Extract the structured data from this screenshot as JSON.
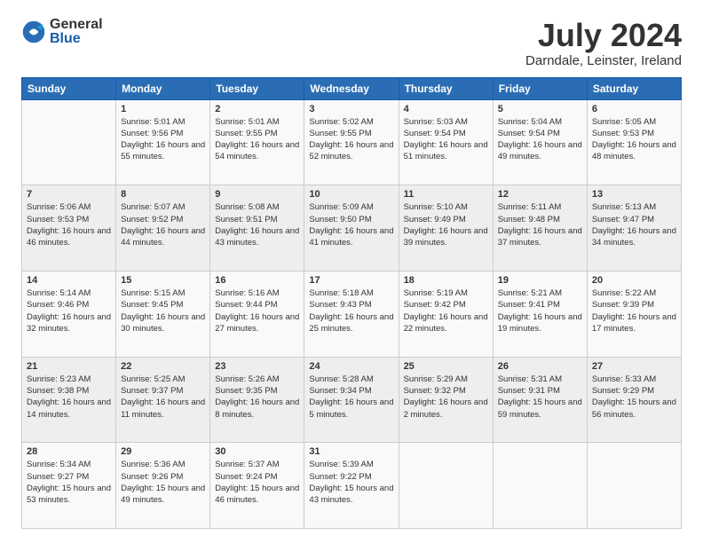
{
  "logo": {
    "general": "General",
    "blue": "Blue"
  },
  "title": "July 2024",
  "location": "Darndale, Leinster, Ireland",
  "days_of_week": [
    "Sunday",
    "Monday",
    "Tuesday",
    "Wednesday",
    "Thursday",
    "Friday",
    "Saturday"
  ],
  "weeks": [
    [
      {
        "day": "",
        "sunrise": "",
        "sunset": "",
        "daylight": ""
      },
      {
        "day": "1",
        "sunrise": "Sunrise: 5:01 AM",
        "sunset": "Sunset: 9:56 PM",
        "daylight": "Daylight: 16 hours and 55 minutes."
      },
      {
        "day": "2",
        "sunrise": "Sunrise: 5:01 AM",
        "sunset": "Sunset: 9:55 PM",
        "daylight": "Daylight: 16 hours and 54 minutes."
      },
      {
        "day": "3",
        "sunrise": "Sunrise: 5:02 AM",
        "sunset": "Sunset: 9:55 PM",
        "daylight": "Daylight: 16 hours and 52 minutes."
      },
      {
        "day": "4",
        "sunrise": "Sunrise: 5:03 AM",
        "sunset": "Sunset: 9:54 PM",
        "daylight": "Daylight: 16 hours and 51 minutes."
      },
      {
        "day": "5",
        "sunrise": "Sunrise: 5:04 AM",
        "sunset": "Sunset: 9:54 PM",
        "daylight": "Daylight: 16 hours and 49 minutes."
      },
      {
        "day": "6",
        "sunrise": "Sunrise: 5:05 AM",
        "sunset": "Sunset: 9:53 PM",
        "daylight": "Daylight: 16 hours and 48 minutes."
      }
    ],
    [
      {
        "day": "7",
        "sunrise": "Sunrise: 5:06 AM",
        "sunset": "Sunset: 9:53 PM",
        "daylight": "Daylight: 16 hours and 46 minutes."
      },
      {
        "day": "8",
        "sunrise": "Sunrise: 5:07 AM",
        "sunset": "Sunset: 9:52 PM",
        "daylight": "Daylight: 16 hours and 44 minutes."
      },
      {
        "day": "9",
        "sunrise": "Sunrise: 5:08 AM",
        "sunset": "Sunset: 9:51 PM",
        "daylight": "Daylight: 16 hours and 43 minutes."
      },
      {
        "day": "10",
        "sunrise": "Sunrise: 5:09 AM",
        "sunset": "Sunset: 9:50 PM",
        "daylight": "Daylight: 16 hours and 41 minutes."
      },
      {
        "day": "11",
        "sunrise": "Sunrise: 5:10 AM",
        "sunset": "Sunset: 9:49 PM",
        "daylight": "Daylight: 16 hours and 39 minutes."
      },
      {
        "day": "12",
        "sunrise": "Sunrise: 5:11 AM",
        "sunset": "Sunset: 9:48 PM",
        "daylight": "Daylight: 16 hours and 37 minutes."
      },
      {
        "day": "13",
        "sunrise": "Sunrise: 5:13 AM",
        "sunset": "Sunset: 9:47 PM",
        "daylight": "Daylight: 16 hours and 34 minutes."
      }
    ],
    [
      {
        "day": "14",
        "sunrise": "Sunrise: 5:14 AM",
        "sunset": "Sunset: 9:46 PM",
        "daylight": "Daylight: 16 hours and 32 minutes."
      },
      {
        "day": "15",
        "sunrise": "Sunrise: 5:15 AM",
        "sunset": "Sunset: 9:45 PM",
        "daylight": "Daylight: 16 hours and 30 minutes."
      },
      {
        "day": "16",
        "sunrise": "Sunrise: 5:16 AM",
        "sunset": "Sunset: 9:44 PM",
        "daylight": "Daylight: 16 hours and 27 minutes."
      },
      {
        "day": "17",
        "sunrise": "Sunrise: 5:18 AM",
        "sunset": "Sunset: 9:43 PM",
        "daylight": "Daylight: 16 hours and 25 minutes."
      },
      {
        "day": "18",
        "sunrise": "Sunrise: 5:19 AM",
        "sunset": "Sunset: 9:42 PM",
        "daylight": "Daylight: 16 hours and 22 minutes."
      },
      {
        "day": "19",
        "sunrise": "Sunrise: 5:21 AM",
        "sunset": "Sunset: 9:41 PM",
        "daylight": "Daylight: 16 hours and 19 minutes."
      },
      {
        "day": "20",
        "sunrise": "Sunrise: 5:22 AM",
        "sunset": "Sunset: 9:39 PM",
        "daylight": "Daylight: 16 hours and 17 minutes."
      }
    ],
    [
      {
        "day": "21",
        "sunrise": "Sunrise: 5:23 AM",
        "sunset": "Sunset: 9:38 PM",
        "daylight": "Daylight: 16 hours and 14 minutes."
      },
      {
        "day": "22",
        "sunrise": "Sunrise: 5:25 AM",
        "sunset": "Sunset: 9:37 PM",
        "daylight": "Daylight: 16 hours and 11 minutes."
      },
      {
        "day": "23",
        "sunrise": "Sunrise: 5:26 AM",
        "sunset": "Sunset: 9:35 PM",
        "daylight": "Daylight: 16 hours and 8 minutes."
      },
      {
        "day": "24",
        "sunrise": "Sunrise: 5:28 AM",
        "sunset": "Sunset: 9:34 PM",
        "daylight": "Daylight: 16 hours and 5 minutes."
      },
      {
        "day": "25",
        "sunrise": "Sunrise: 5:29 AM",
        "sunset": "Sunset: 9:32 PM",
        "daylight": "Daylight: 16 hours and 2 minutes."
      },
      {
        "day": "26",
        "sunrise": "Sunrise: 5:31 AM",
        "sunset": "Sunset: 9:31 PM",
        "daylight": "Daylight: 15 hours and 59 minutes."
      },
      {
        "day": "27",
        "sunrise": "Sunrise: 5:33 AM",
        "sunset": "Sunset: 9:29 PM",
        "daylight": "Daylight: 15 hours and 56 minutes."
      }
    ],
    [
      {
        "day": "28",
        "sunrise": "Sunrise: 5:34 AM",
        "sunset": "Sunset: 9:27 PM",
        "daylight": "Daylight: 15 hours and 53 minutes."
      },
      {
        "day": "29",
        "sunrise": "Sunrise: 5:36 AM",
        "sunset": "Sunset: 9:26 PM",
        "daylight": "Daylight: 15 hours and 49 minutes."
      },
      {
        "day": "30",
        "sunrise": "Sunrise: 5:37 AM",
        "sunset": "Sunset: 9:24 PM",
        "daylight": "Daylight: 15 hours and 46 minutes."
      },
      {
        "day": "31",
        "sunrise": "Sunrise: 5:39 AM",
        "sunset": "Sunset: 9:22 PM",
        "daylight": "Daylight: 15 hours and 43 minutes."
      },
      {
        "day": "",
        "sunrise": "",
        "sunset": "",
        "daylight": ""
      },
      {
        "day": "",
        "sunrise": "",
        "sunset": "",
        "daylight": ""
      },
      {
        "day": "",
        "sunrise": "",
        "sunset": "",
        "daylight": ""
      }
    ]
  ]
}
